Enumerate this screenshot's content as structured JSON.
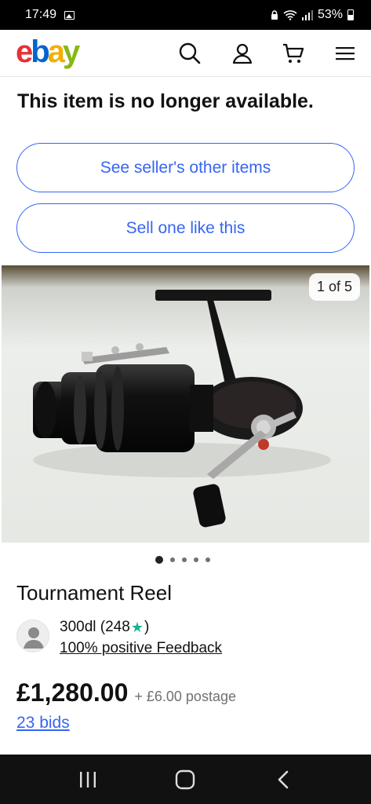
{
  "status_bar": {
    "time": "17:49",
    "battery": "53%",
    "icons": [
      "gallery-icon",
      "lock-icon",
      "wifi-icon",
      "signal-icon",
      "battery-icon"
    ]
  },
  "header": {
    "logo_letters": [
      "e",
      "b",
      "a",
      "y"
    ],
    "icons": [
      "search-icon",
      "account-icon",
      "cart-icon",
      "menu-icon"
    ]
  },
  "notice": "This item is no longer available.",
  "buttons": {
    "sellers_items": "See seller's other items",
    "sell_like": "Sell one like this"
  },
  "gallery": {
    "counter": "1 of 5",
    "dot_count": 5,
    "active_index": 0
  },
  "listing": {
    "title": "Tournament Reel",
    "seller": {
      "name": "300dl",
      "score_open": "(248",
      "score_close": ")",
      "feedback": "100% positive Feedback"
    },
    "price": "£1,280.00",
    "postage": "+ £6.00 postage",
    "bids": "23 bids"
  },
  "colors": {
    "link": "#3665f3",
    "star": "#1ab394",
    "logo_e": "#e53238",
    "logo_b": "#0064d2",
    "logo_a": "#f5af02",
    "logo_y": "#86b817"
  },
  "nav": {
    "icons": [
      "recent-apps-icon",
      "home-icon",
      "back-icon"
    ]
  }
}
